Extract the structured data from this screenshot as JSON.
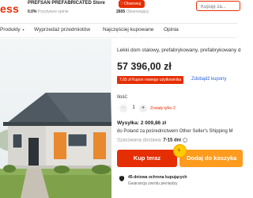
{
  "header": {
    "logo": "ess",
    "store_name": "PREFSAN PREFABRICATED Store",
    "store_rating_value": "0.0%",
    "store_rating_label": "Pozytywne opinie",
    "follow_label": "Obserwuj",
    "followers_count": "2605",
    "followers_label": "Obserwujący",
    "search_placeholder": "Kupuję za..."
  },
  "nav": {
    "items": [
      "Produkty",
      "Wyprzedaż przedmiotów",
      "Najczęściej kupowane",
      "Opinia"
    ]
  },
  "product": {
    "title": "Lekki dom stalowy, prefabrykowany, prefabrykowany d",
    "price": "57 396,00 zł",
    "coupon_badge": "7,65 zł Kupon nowego użytkownika",
    "get_coupons": "Zdobądź kupony",
    "quantity_label": "Ilość:",
    "quantity_value": "1",
    "stock_text": "Zostały tylko 2",
    "shipping_title": "Wysyłka: 2 009,86 zł",
    "ship_from": "do Poland za pośrednictwem Other Seller's Shipping M",
    "delivery_label": "Szacowana dostawa:",
    "delivery_value": "7-15 dni",
    "buy_now": "Kup teraz",
    "add_to_cart": "Dodaj do koszyka",
    "protection_title": "45-dniowa ochrona kupujących",
    "protection_sub": "Gwarancja zwrotu pieniędzy"
  },
  "colors": {
    "brand_red": "#e62e04",
    "cart_orange": "#ff9b1d",
    "link_blue": "#2a64d9"
  },
  "icons": [
    "heart-icon",
    "chevron-down-icon",
    "minus-icon",
    "plus-icon",
    "info-icon",
    "cart-icon",
    "shield-icon"
  ]
}
